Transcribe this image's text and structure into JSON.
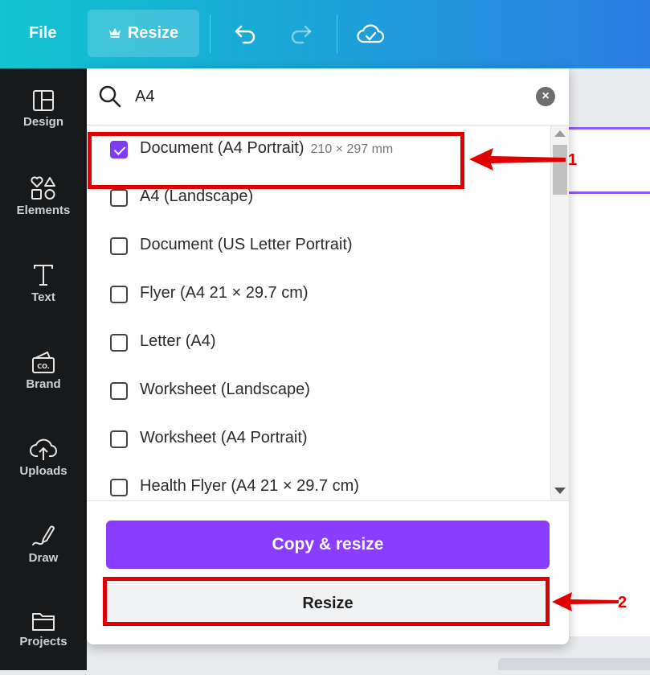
{
  "topbar": {
    "file_label": "File",
    "resize_label": "Resize",
    "icons": [
      "crown-icon",
      "undo-icon",
      "redo-icon",
      "cloud-check-icon"
    ]
  },
  "sidebar": {
    "items": [
      {
        "label": "Design",
        "icon": "design-layout-icon"
      },
      {
        "label": "Elements",
        "icon": "shapes-icon"
      },
      {
        "label": "Text",
        "icon": "text-t-icon"
      },
      {
        "label": "Brand",
        "icon": "brand-kit-icon"
      },
      {
        "label": "Uploads",
        "icon": "cloud-upload-icon"
      },
      {
        "label": "Draw",
        "icon": "pen-draw-icon"
      },
      {
        "label": "Projects",
        "icon": "folder-icon"
      }
    ]
  },
  "search": {
    "value": "A4"
  },
  "options": [
    {
      "label": "Document (A4 Portrait)",
      "size": "210 × 297 mm",
      "checked": true
    },
    {
      "label": "A4 (Landscape)",
      "size": "",
      "checked": false
    },
    {
      "label": "Document (US Letter Portrait)",
      "size": "",
      "checked": false
    },
    {
      "label": "Flyer (A4 21 × 29.7 cm)",
      "size": "",
      "checked": false
    },
    {
      "label": "Letter (A4)",
      "size": "",
      "checked": false
    },
    {
      "label": "Worksheet (Landscape)",
      "size": "",
      "checked": false
    },
    {
      "label": "Worksheet (A4 Portrait)",
      "size": "",
      "checked": false
    },
    {
      "label": "Health Flyer (A4 21 × 29.7 cm)",
      "size": "",
      "checked": false
    }
  ],
  "buttons": {
    "copy_resize": "Copy & resize",
    "resize": "Resize"
  },
  "annotations": {
    "one": "1",
    "two": "2"
  },
  "colors": {
    "accent": "#8b3dff",
    "highlight": "#e00000",
    "sidebar_bg": "#18191b"
  }
}
